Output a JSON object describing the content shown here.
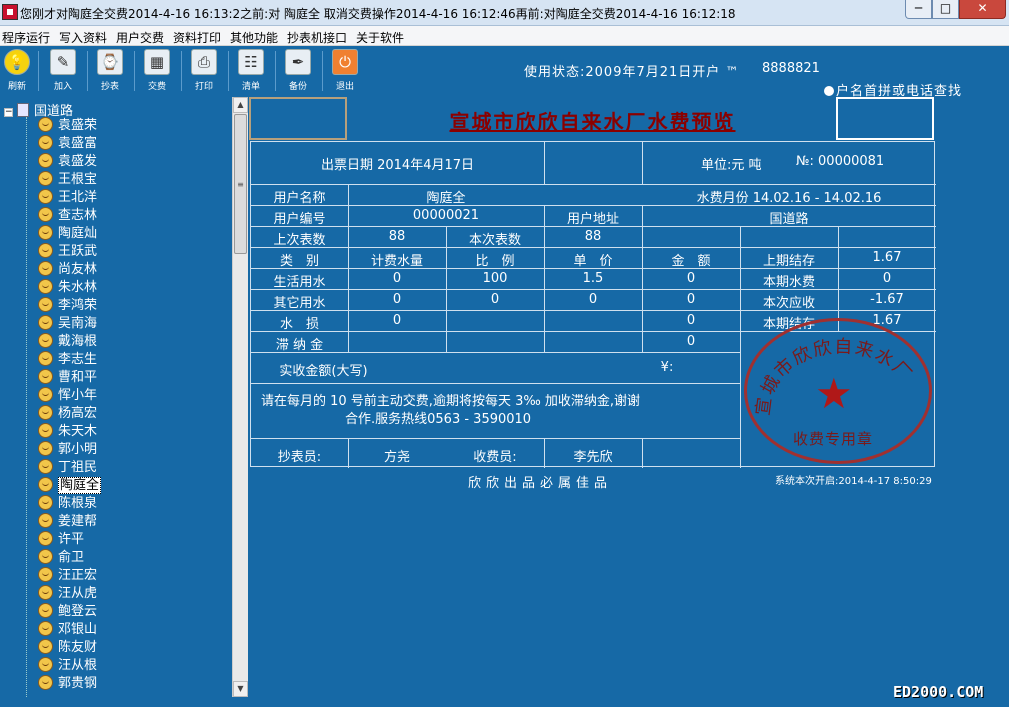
{
  "window": {
    "title": "您刚才对陶庭全交费2014-4-16 16:13:2之前:对 陶庭全 取消交费操作2014-4-16 16:12:46再前:对陶庭全交费2014-4-16 16:12:18",
    "min_label": "─",
    "max_label": "□",
    "close_label": "✕"
  },
  "menu": {
    "items": [
      "程序运行",
      "写入资料",
      "用户交费",
      "资料打印",
      "其他功能",
      "抄表机接口",
      "关于软件"
    ]
  },
  "toolbar": {
    "buttons": [
      {
        "label": "刷新",
        "icon": "refresh-icon",
        "glyph": "💡"
      },
      {
        "label": "加入",
        "icon": "add-icon",
        "glyph": "✎"
      },
      {
        "label": "抄表",
        "icon": "meter-icon",
        "glyph": "⌚"
      },
      {
        "label": "交费",
        "icon": "calculator-icon",
        "glyph": "▦"
      },
      {
        "label": "打印",
        "icon": "printer-icon",
        "glyph": "⎙"
      },
      {
        "label": "清单",
        "icon": "list-icon",
        "glyph": "☷"
      },
      {
        "label": "备份",
        "icon": "backup-icon",
        "glyph": "✒"
      },
      {
        "label": "退出",
        "icon": "exit-icon",
        "glyph": "⏻"
      }
    ]
  },
  "status": {
    "usage": "使用状态:2009年7月21日开户 ™",
    "phone": "8888821",
    "search_option": "户名首拼或电话查找"
  },
  "tree": {
    "root": "国道路",
    "items": [
      "袁盛荣",
      "袁盛富",
      "袁盛发",
      "王根宝",
      "王北洋",
      "查志林",
      "陶庭灿",
      "王跃武",
      "尚友林",
      "朱水林",
      "李鸿荣",
      "吴南海",
      "戴海根",
      "李志生",
      "曹和平",
      "恽小年",
      "杨高宏",
      "朱天木",
      "郭小明",
      "丁祖民",
      "陶庭全",
      "陈根泉",
      "姜建帮",
      "许平",
      "俞卫",
      "汪正宏",
      "汪从虎",
      "鲍登云",
      "邓银山",
      "陈友财",
      "汪从根",
      "郭贵钢"
    ],
    "selected_index": 20
  },
  "receipt": {
    "title": "宣城市欣欣自来水厂水费预览",
    "issue_date": "出票日期 2014年4月17日",
    "unit": "单位:元 吨",
    "number": "№: 00000081",
    "user_name_label": "用户名称",
    "user_name": "陶庭全",
    "billing_period": "水费月份 14.02.16 - 14.02.16",
    "user_no_label": "用户编号",
    "user_no": "00000021",
    "address_label": "用户地址",
    "address": "国道路",
    "prev_reading_label": "上次表数",
    "prev_reading": "88",
    "curr_reading_label": "本次表数",
    "curr_reading": "88",
    "col_type": "类　别",
    "col_volume": "计费水量",
    "col_ratio": "比　例",
    "col_price": "单　价",
    "col_amount": "金　额",
    "rows": [
      {
        "type": "生活用水",
        "volume": "0",
        "ratio": "100",
        "price": "1.5",
        "amount": "0"
      },
      {
        "type": "其它用水",
        "volume": "0",
        "ratio": "0",
        "price": "0",
        "amount": "0"
      },
      {
        "type": "水　损",
        "volume": "0",
        "ratio": "",
        "price": "",
        "amount": "0"
      },
      {
        "type": "滞 纳 金",
        "volume": "",
        "ratio": "",
        "price": "",
        "amount": "0"
      }
    ],
    "summary": [
      {
        "label": "上期结存",
        "value": "1.67"
      },
      {
        "label": "本期水费",
        "value": "0"
      },
      {
        "label": "本次应收",
        "value": "-1.67"
      },
      {
        "label": "本期结存",
        "value": "1.67"
      }
    ],
    "actual_label": "实收金额(大写)",
    "yen": "¥:",
    "notice_line1": "请在每月的 10 号前主动交费,逾期将按每天 3‰ 加收滞纳金,谢谢",
    "notice_line2": "合作.服务热线0563 - 3590010",
    "reader_label": "抄表员:",
    "reader": "方尧",
    "collector_label": "收费员:",
    "collector": "李先欣",
    "stamp_arc": "宣城市欣欣自来水厂",
    "stamp_bottom": "收费专用章",
    "stamp_star": "★"
  },
  "footer": {
    "slogan": "欣欣出品必属佳品",
    "system_time": "系统本次开启:2014-4-17  8:50:29",
    "watermark": "ED2000.COM"
  }
}
